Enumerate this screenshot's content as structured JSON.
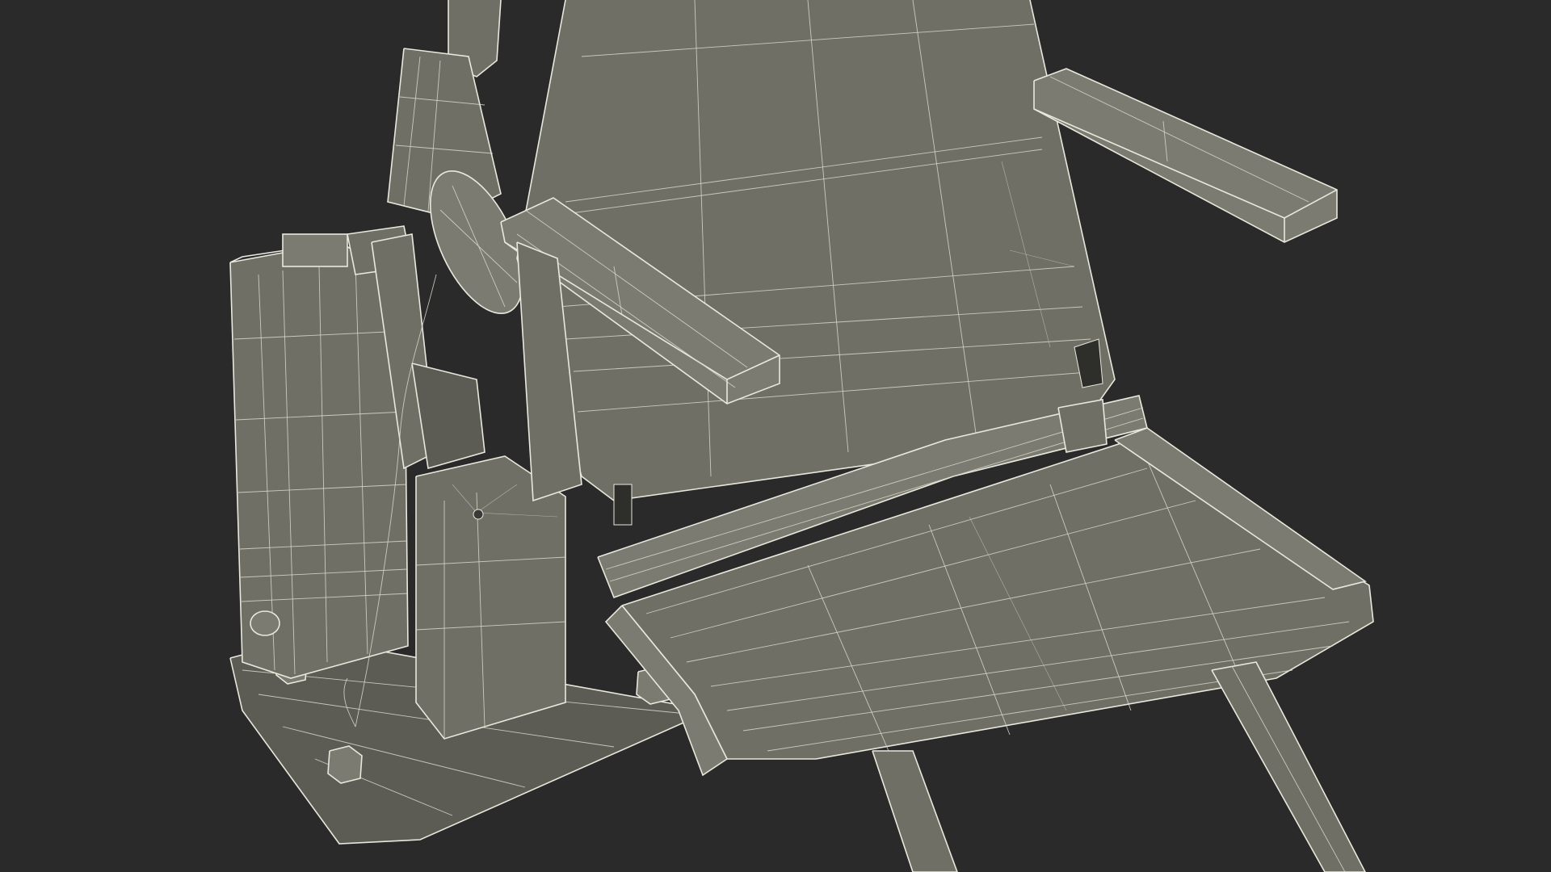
{
  "scene": {
    "subject": "wireframe-seat-model",
    "colors": {
      "background": "#2a2a2a",
      "surface": "#6f6f66",
      "wire": "#e8e8dc"
    }
  }
}
